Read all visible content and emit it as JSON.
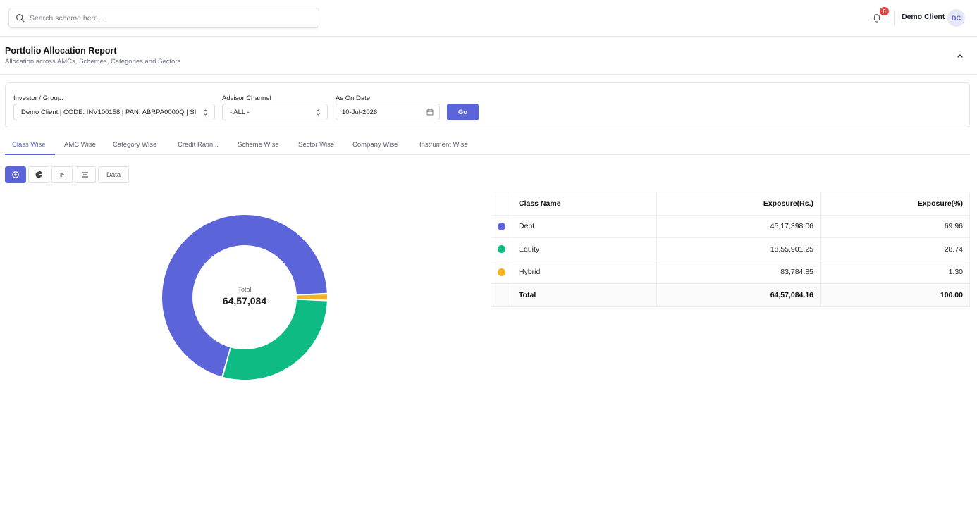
{
  "search": {
    "placeholder": "Search scheme here..."
  },
  "header": {
    "notification_count": "0",
    "user_name": "Demo Client",
    "avatar_initials": "DC"
  },
  "report": {
    "title": "Portfolio Allocation Report",
    "subtitle": "Allocation across AMCs, Schemes, Categories and Sectors"
  },
  "filters": {
    "investor_label": "Investor / Group:",
    "investor_value": "Demo Client | CODE: INV100158 | PAN: ABRPA0000Q | SI",
    "advisor_label": "Advisor Channel",
    "advisor_value": "- ALL -",
    "date_label": "As On Date",
    "date_value": "10-Jul-2026",
    "go_label": "Go"
  },
  "tabs": [
    {
      "label": "Class Wise",
      "active": true
    },
    {
      "label": "AMC Wise"
    },
    {
      "label": "Category Wise"
    },
    {
      "label": "Credit Ratin..."
    },
    {
      "label": "Scheme Wise"
    },
    {
      "label": "Sector Wise"
    },
    {
      "label": "Company Wise"
    },
    {
      "label": "Instrument Wise"
    }
  ],
  "view_buttons": {
    "data_label": "Data"
  },
  "chart_data": {
    "type": "pie",
    "center_label": "Total",
    "center_value": "64,57,084",
    "categories": [
      "Debt",
      "Equity",
      "Hybrid"
    ],
    "values": [
      69.96,
      28.74,
      1.3
    ],
    "colors": [
      "#5b64d8",
      "#0fbb85",
      "#f5b21c"
    ]
  },
  "table": {
    "headers": [
      "Class Name",
      "Exposure(Rs.)",
      "Exposure(%)"
    ],
    "rows": [
      {
        "name": "Debt",
        "amount": "45,17,398.06",
        "pct": "69.96",
        "color": "#5b64d8"
      },
      {
        "name": "Equity",
        "amount": "18,55,901.25",
        "pct": "28.74",
        "color": "#0fbb85"
      },
      {
        "name": "Hybrid",
        "amount": "83,784.85",
        "pct": "1.30",
        "color": "#f5b21c"
      }
    ],
    "total": {
      "name": "Total",
      "amount": "64,57,084.16",
      "pct": "100.00"
    }
  }
}
